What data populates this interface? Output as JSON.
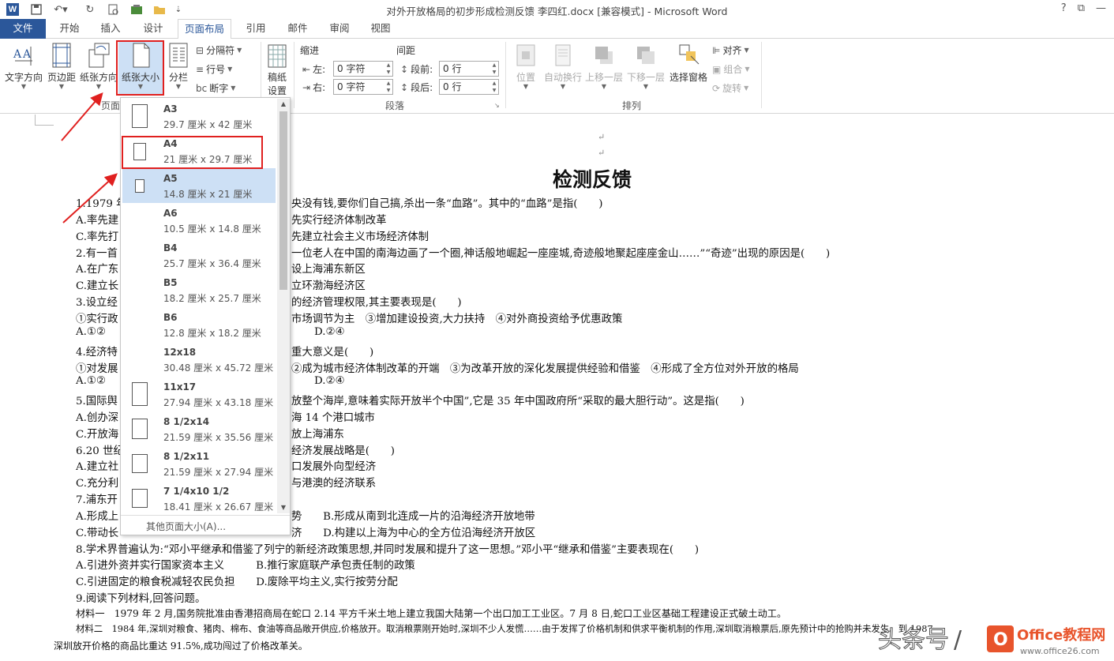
{
  "window": {
    "title": "对外开放格局的初步形成检测反馈 李四红.docx [兼容模式] - Microsoft Word",
    "controls": [
      "?",
      "⧉",
      "—"
    ]
  },
  "tabs": [
    "文件",
    "开始",
    "插入",
    "设计",
    "页面布局",
    "引用",
    "邮件",
    "审阅",
    "视图"
  ],
  "ribbon": {
    "text_direction": "文字方向",
    "margins": "页边距",
    "orientation": "纸张方向",
    "size": "纸张大小",
    "columns": "分栏",
    "breaks": "分隔符",
    "line_numbers": "行号",
    "hyphenation": "断字",
    "page_setup_group": "页面",
    "draft": "稿纸",
    "draft2": "设置",
    "indent_title": "缩进",
    "spacing_title": "间距",
    "indent_left_label": "左:",
    "indent_left_value": "0 字符",
    "indent_right_label": "右:",
    "indent_right_value": "0 字符",
    "space_before_label": "段前:",
    "space_before_value": "0 行",
    "space_after_label": "段后:",
    "space_after_value": "0 行",
    "paragraph_group": "段落",
    "position": "位置",
    "wrap_text": "自动换行",
    "bring_forward": "上移一层",
    "send_backward": "下移一层",
    "selection_pane": "选择窗格",
    "align": "对齐",
    "group": "组合",
    "rotate": "旋转",
    "arrange_group": "排列"
  },
  "paper_sizes": [
    {
      "name": "A3",
      "dim": "29.7 厘米 x 42 厘米",
      "icon": "portrait-page-icon"
    },
    {
      "name": "A4",
      "dim": "21 厘米 x 29.7 厘米",
      "icon": "portrait-page-icon"
    },
    {
      "name": "A5",
      "dim": "14.8 厘米 x 21 厘米",
      "icon": "portrait-page-icon"
    },
    {
      "name": "A6",
      "dim": "10.5 厘米 x 14.8 厘米",
      "icon": ""
    },
    {
      "name": "B4",
      "dim": "25.7 厘米 x 36.4 厘米",
      "icon": ""
    },
    {
      "name": "B5",
      "dim": "18.2 厘米 x 25.7 厘米",
      "icon": ""
    },
    {
      "name": "B6",
      "dim": "12.8 厘米 x 18.2 厘米",
      "icon": ""
    },
    {
      "name": "12x18",
      "dim": "30.48 厘米 x 45.72 厘米",
      "icon": ""
    },
    {
      "name": "11x17",
      "dim": "27.94 厘米 x 43.18 厘米",
      "icon": "portrait-page-icon"
    },
    {
      "name": "8 1/2x14",
      "dim": "21.59 厘米 x 35.56 厘米",
      "icon": "portrait-page-icon"
    },
    {
      "name": "8 1/2x11",
      "dim": "21.59 厘米 x 27.94 厘米",
      "icon": "portrait-page-icon"
    },
    {
      "name": "7 1/4x10 1/2",
      "dim": "18.41 厘米 x 26.67 厘米",
      "icon": "portrait-page-icon"
    }
  ],
  "paper_selected": "A5",
  "more_sizes": "其他页面大小(A)...",
  "document": {
    "heading": "检测反馈",
    "lines": [
      "1.1979 年",
      "央没有钱,要你们自己搞,杀出一条“血路”。其中的“血路”是指(　　)",
      "A.率先建",
      "先实行经济体制改革",
      "C.率先打",
      "先建立社会主义市场经济体制",
      "2.有一首",
      "一位老人在中国的南海边画了一个圈,神话般地崛起一座座城,奇迹般地聚起座座金山……”“奇迹”出现的原因是(　　)",
      "A.在广东",
      "设上海浦东新区",
      "C.建立长",
      "立环渤海经济区",
      "3.设立经",
      "的经济管理权限,其主要表现是(　　)",
      "①实行政",
      "市场调节为主　③增加建设投资,大力扶持　④对外商投资给予优惠政策",
      "A.①②",
      "D.②④",
      "4.经济特",
      "重大意义是(　　)",
      "①对发展",
      "②成为城市经济体制改革的开端　③为改革开放的深化发展提供经验和借鉴　④形成了全方位对外开放的格局",
      "A.①②",
      "D.②④",
      "5.国际舆",
      "放整个海岸,意味着实际开放半个中国”,它是 35 年中国政府所“采取的最大胆行动”。这是指(　　)",
      "A.创办深",
      "海 14 个港口城市",
      "C.开放海",
      "放上海浦东",
      "6.20 世纪",
      "经济发展战略是(　　)",
      "A.建立社",
      "口发展外向型经济",
      "C.充分利",
      "与港澳的经济联系",
      "7.浦东开",
      "A.形成上",
      "势　　B.形成从南到北连成一片的沿海经济开放地带",
      "C.带动长",
      "济　　D.构建以上海为中心的全方位沿海经济开放区",
      "8.学术界普遍认为:“邓小平继承和借鉴了列宁的新经济政策思想,并同时发展和提升了这一思想。”邓小平“继承和借鉴”主要表现在(　　)",
      "A.引进外资并实行国家资本主义　　　B.推行家庭联产承包责任制的政策",
      "C.引进固定的粮食税减轻农民负担　　D.废除平均主义,实行按劳分配",
      "9.阅读下列材料,回答问题。",
      "材料一　1979 年 2 月,国务院批准由香港招商局在蛇口 2.14 平方千米土地上建立我国大陆第一个出口加工工业区。7 月 8 日,蛇口工业区基础工程建设正式破土动工。",
      "材料二　1984 年,深圳对粮食、猪肉、棉布、食油等商品敞开供应,价格放开。取消粮票刚开始时,深圳不少人发慌……由于发挥了价格机制和供求平衡机制的作用,深圳取消粮票后,原先预计中的抢购并未发生。到 1987",
      "深圳放开价格的商品比重达 91.5%,成功闯过了价格改革关。"
    ]
  },
  "watermark": "头条号 / Office教程网 www.office26.com"
}
